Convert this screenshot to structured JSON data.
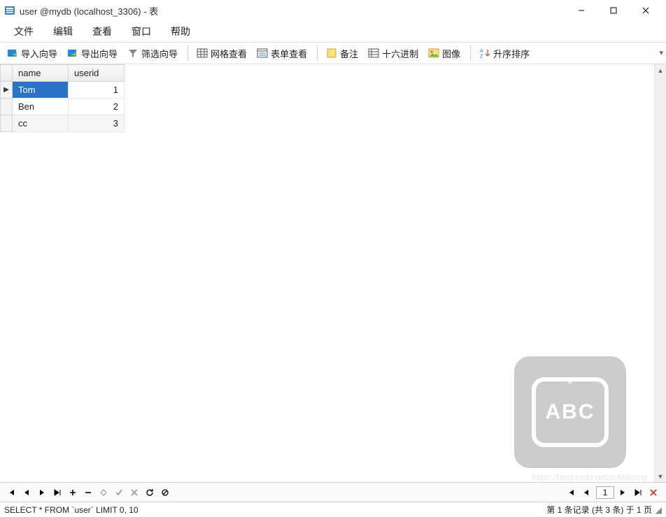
{
  "window": {
    "title": "user @mydb (localhost_3306) - 表"
  },
  "menubar": {
    "items": [
      "文件",
      "编辑",
      "查看",
      "窗口",
      "帮助"
    ]
  },
  "toolbar": {
    "import_wizard": "导入向导",
    "export_wizard": "导出向导",
    "filter_wizard": "筛选向导",
    "grid_view": "网格查看",
    "form_view": "表单查看",
    "memo": "备注",
    "hex": "十六进制",
    "image": "图像",
    "sort_asc": "升序排序"
  },
  "table": {
    "columns": [
      "name",
      "userid"
    ],
    "rows": [
      {
        "name": "Tom",
        "userid": "1",
        "selected": true,
        "indicator": "▶"
      },
      {
        "name": "Ben",
        "userid": "2",
        "selected": false,
        "indicator": ""
      },
      {
        "name": "cc",
        "userid": "3",
        "selected": false,
        "indicator": ""
      }
    ]
  },
  "ime": {
    "lang": "ABC"
  },
  "pager": {
    "page": "1"
  },
  "status": {
    "query": "SELECT * FROM `user` LIMIT 0, 10",
    "record_info": "第 1 条记录 (共 3 条) 于 1 页"
  },
  "watermark": "https://blog.csdn.net/zc666ying"
}
